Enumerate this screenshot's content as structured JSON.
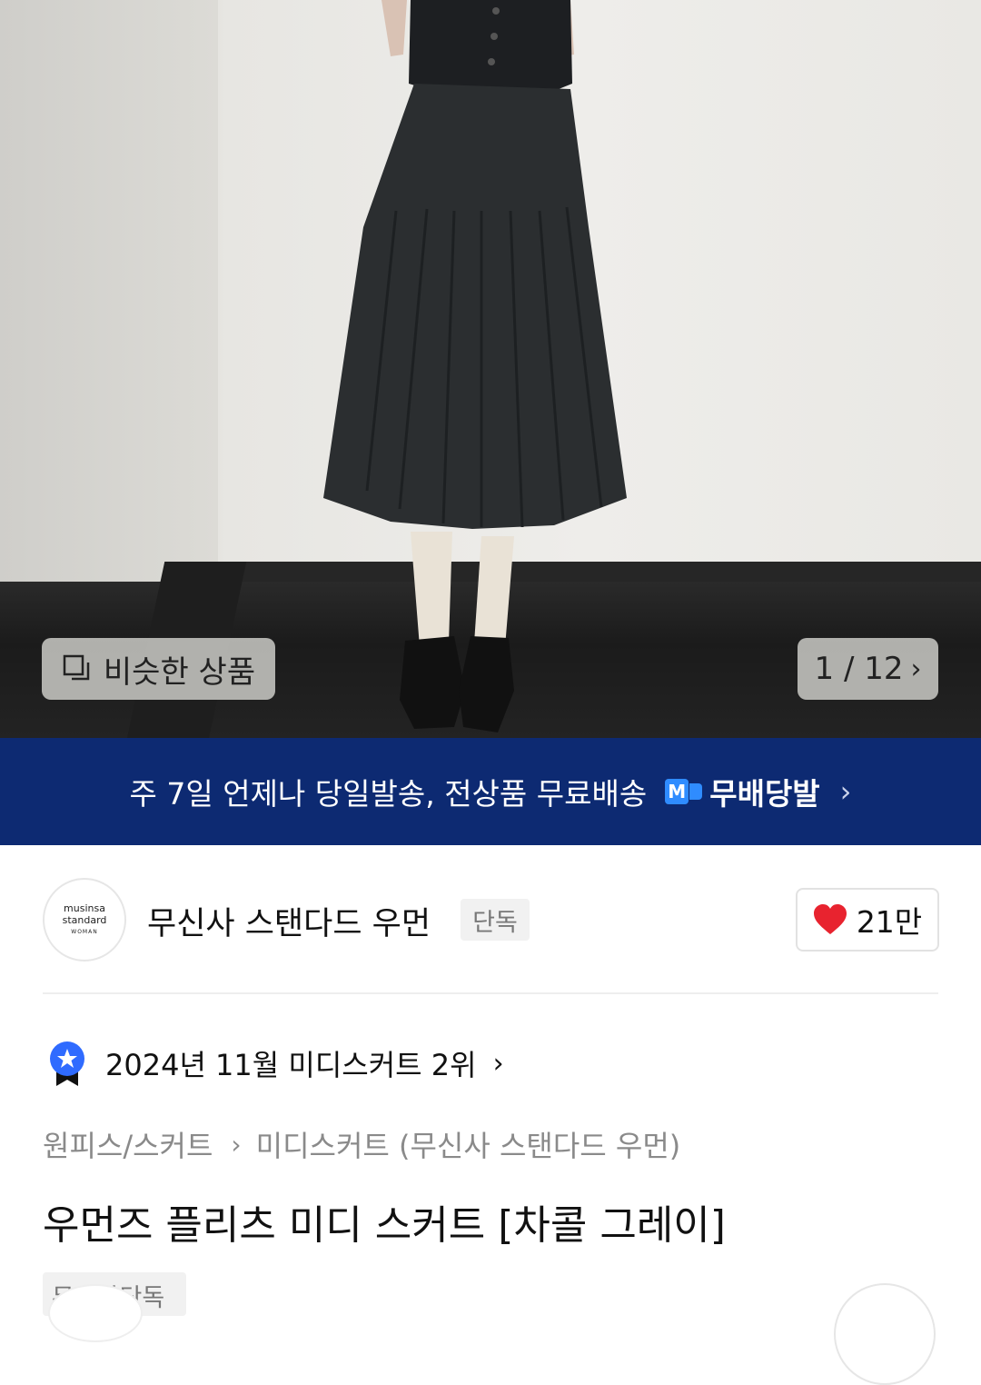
{
  "gallery": {
    "similar_label": "비슷한 상품",
    "similar_icon": "similar-items-icon",
    "pager": "1 / 12"
  },
  "banner": {
    "text": "주 7일 언제나 당일발송, 전상품 무료배송",
    "brand_mark": "M",
    "brand_text": "무배당발",
    "bg_color": "#0d2a72"
  },
  "brand": {
    "logo_line1": "musinsa",
    "logo_line2": "standard",
    "logo_line3": "WOMAN",
    "name": "무신사 스탠다드 우먼",
    "tag": "단독",
    "likes": "21만"
  },
  "ranking": {
    "text": "2024년 11월 미디스커트 2위",
    "badge_color": "#2f6bff"
  },
  "breadcrumb": {
    "level1": "원피스/스커트",
    "level2": "미디스커트 (무신사 스탠다드 우먼)"
  },
  "product": {
    "title": "우먼즈 플리츠 미디 스커트 [차콜 그레이]",
    "tag": "무신사단독"
  }
}
